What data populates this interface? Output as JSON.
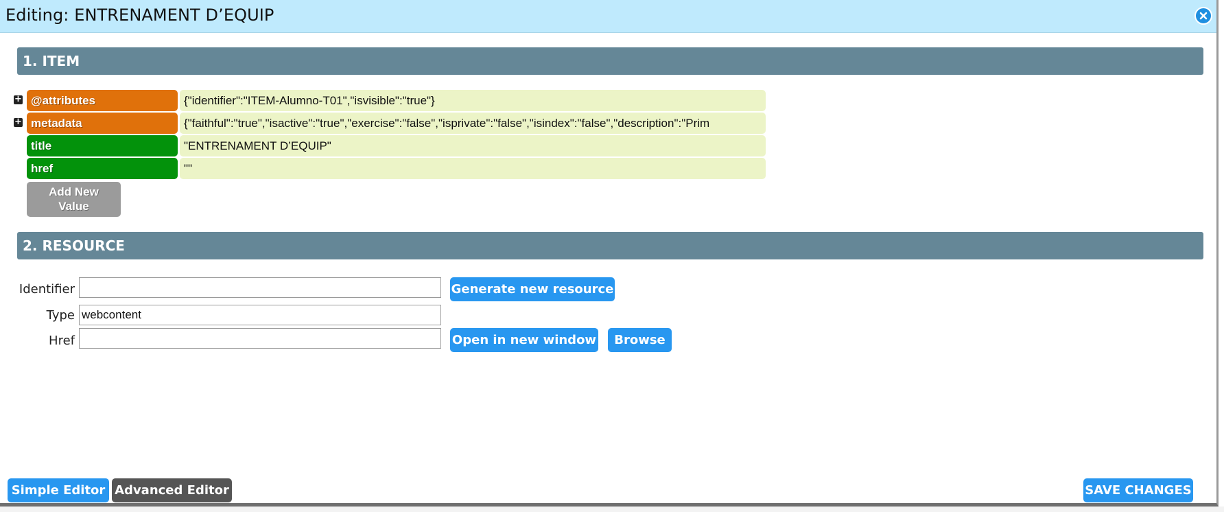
{
  "window": {
    "title": "Editing: ENTRENAMENT D’EQUIP"
  },
  "sections": {
    "item_header": "1. ITEM",
    "resource_header": "2. RESOURCE"
  },
  "item_rows": [
    {
      "key": "@attributes",
      "value": "{\"identifier\":\"ITEM-Alumno-T01\",\"isvisible\":\"true\"}",
      "expand": "+"
    },
    {
      "key": "metadata",
      "value": "{\"faithful\":\"true\",\"isactive\":\"true\",\"exercise\":\"false\",\"isprivate\":\"false\",\"isindex\":\"false\",\"description\":\"Prim",
      "expand": "+"
    },
    {
      "key": "title",
      "value": "\"ENTRENAMENT D’EQUIP\""
    },
    {
      "key": "href",
      "value": "\"\""
    }
  ],
  "add_value_button": {
    "line1": "Add New",
    "line2": "Value"
  },
  "resource_form": {
    "identifier_label": "Identifier",
    "identifier_value": "",
    "type_label": "Type",
    "type_value": "webcontent",
    "href_label": "Href",
    "href_value": ""
  },
  "buttons": {
    "generate": "Generate new resource",
    "open_new_window": "Open in new window",
    "browse": "Browse",
    "simple_editor": "Simple Editor",
    "advanced_editor": "Advanced Editor",
    "save_changes": "SAVE CHANGES"
  },
  "colors": {
    "titlebar": "#bfeafd",
    "section_header": "#658797",
    "key_orange": "#e0710b",
    "key_green": "#03920b",
    "value_bg": "#ecf4c7",
    "button_blue": "#2897f0",
    "button_dark": "#555555",
    "button_gray": "#9b9b9b"
  }
}
